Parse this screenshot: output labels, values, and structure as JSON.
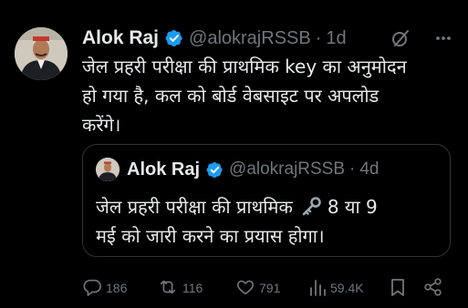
{
  "tweet": {
    "author_name": "Alok Raj",
    "handle": "@alokrajRSSB",
    "separator": "·",
    "time": "1d",
    "text_lines": [
      "जेल प्रहरी परीक्षा की प्राथमिक key का अनुमोदन",
      "हो गया है, कल को बोर्ड वेबसाइट पर अपलोड",
      "करेंगे।"
    ]
  },
  "quoted": {
    "author_name": "Alok Raj",
    "handle": "@alokrajRSSB",
    "separator": "·",
    "time": "4d",
    "line1_before": "जेल प्रहरी परीक्षा की प्राथमिक",
    "line1_after": "8 या 9",
    "line2": "मई को जारी करने का प्रयास होगा।"
  },
  "actions": {
    "replies": "186",
    "retweets": "116",
    "likes": "791",
    "views": "59.4K"
  },
  "colors": {
    "background": "#000000",
    "text": "#e7e9ea",
    "muted": "#71767b",
    "verified": "#1d9bf0",
    "border": "#2f3336"
  },
  "icons": [
    "verified-badge-icon",
    "grok-icon",
    "more-icon",
    "key-emoji-icon",
    "reply-icon",
    "retweet-icon",
    "like-icon",
    "views-icon",
    "bookmark-icon",
    "share-icon"
  ]
}
